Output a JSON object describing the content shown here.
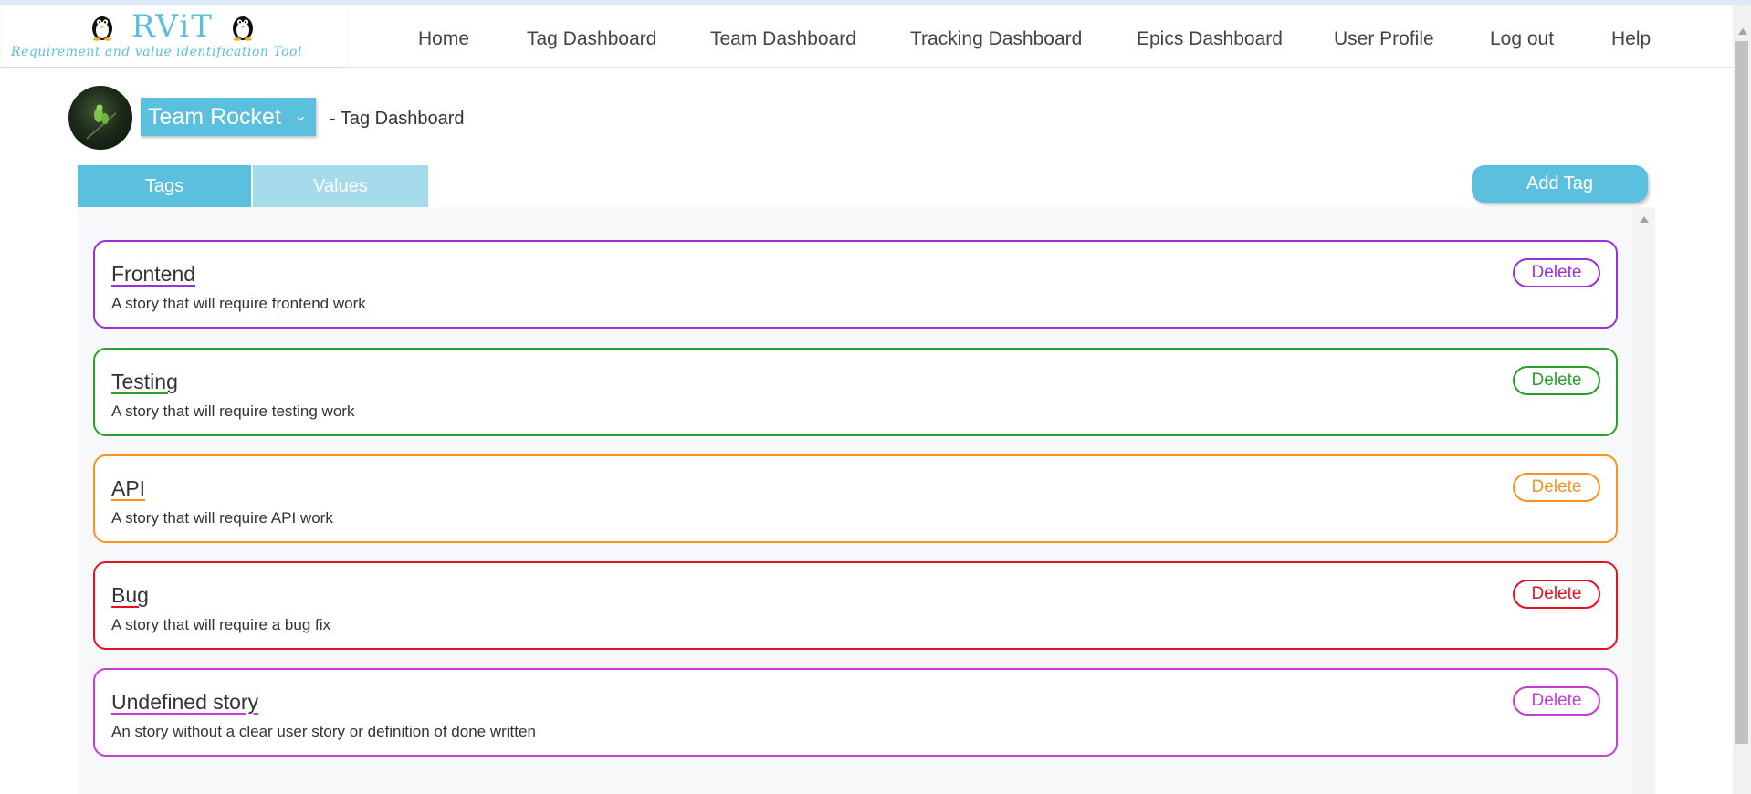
{
  "app": {
    "logo_text": "RViT",
    "logo_subtitle": "Requirement and value identification Tool"
  },
  "nav": {
    "items": [
      {
        "label": "Home"
      },
      {
        "label": "Tag Dashboard"
      },
      {
        "label": "Team Dashboard"
      },
      {
        "label": "Tracking Dashboard"
      },
      {
        "label": "Epics Dashboard"
      },
      {
        "label": "User Profile"
      },
      {
        "label": "Log out"
      },
      {
        "label": "Help"
      }
    ]
  },
  "team": {
    "name": "Team Rocket",
    "breadcrumb": "- Tag Dashboard"
  },
  "tabs": [
    {
      "label": "Tags",
      "active": true
    },
    {
      "label": "Values",
      "active": false
    }
  ],
  "actions": {
    "add_tag_label": "Add Tag"
  },
  "tags": [
    {
      "name": "Frontend",
      "description": "A story that will require frontend work",
      "color": "#9b30d9",
      "delete_label": "Delete"
    },
    {
      "name": "Testing",
      "description": "A story that will require testing work",
      "color": "#2aa02a",
      "delete_label": "Delete"
    },
    {
      "name": "API",
      "description": "A story that will require API work",
      "color": "#f7941d",
      "delete_label": "Delete"
    },
    {
      "name": "Bug",
      "description": "A story that will require a bug fix",
      "color": "#e8121e",
      "delete_label": "Delete"
    },
    {
      "name": "Undefined story",
      "description": "An story without a clear user story or definition of done written",
      "color": "#c43dd6",
      "delete_label": "Delete"
    }
  ],
  "colors": {
    "accent": "#5bc0de",
    "accent_light": "#a5dbeb",
    "panel_bg": "#f7f8f9"
  },
  "icons": {
    "logo_left": "penguin-icon",
    "logo_right": "penguin-icon",
    "team_dropdown": "chevron-down-icon"
  }
}
